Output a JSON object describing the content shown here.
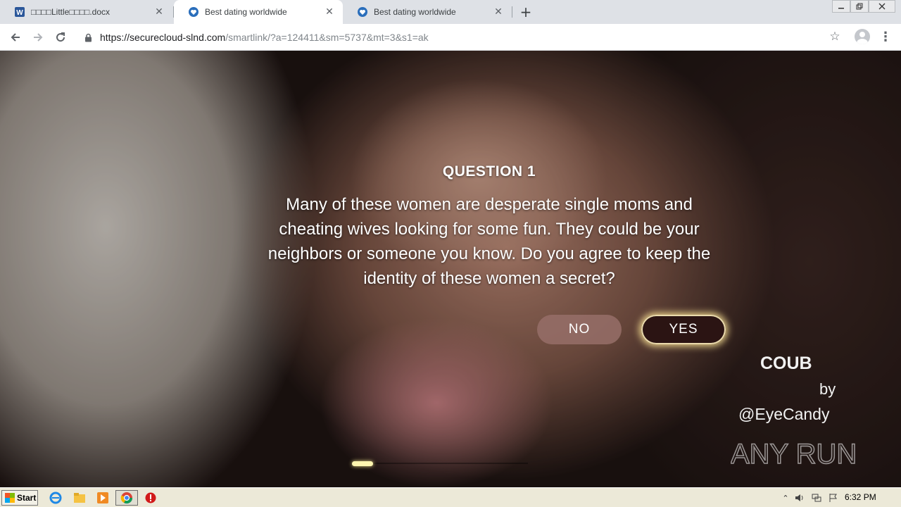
{
  "browser": {
    "tabs": [
      {
        "title": "□□□□Little□□□□.docx",
        "icon": "word-doc-icon"
      },
      {
        "title": "Best dating worldwide",
        "icon": "site-heart-icon"
      },
      {
        "title": "Best dating worldwide",
        "icon": "site-heart-icon"
      }
    ],
    "new_tab_label": "+",
    "url_host": "https://securecloud-slnd.com",
    "url_path": "/smartlink/?a=124411&sm=5737&mt=3&s1=ak"
  },
  "quiz": {
    "title": "QUESTION 1",
    "text": "Many of these women are desperate single moms and cheating wives looking for some fun. They could be your neighbors or someone you know. Do you agree to keep the identity of these women a secret?",
    "no_label": "NO",
    "yes_label": "YES",
    "progress": 0.12
  },
  "video_credit": {
    "brand": "COUB",
    "by": "by",
    "author": "@EyeCandy"
  },
  "watermark": {
    "text": "ANY RUN"
  },
  "taskbar": {
    "start_label": "Start",
    "clock": "6:32 PM"
  },
  "colors": {
    "yes_bg": "#2b1413",
    "no_bg": "#966e69",
    "glow": "#fff6b0"
  }
}
